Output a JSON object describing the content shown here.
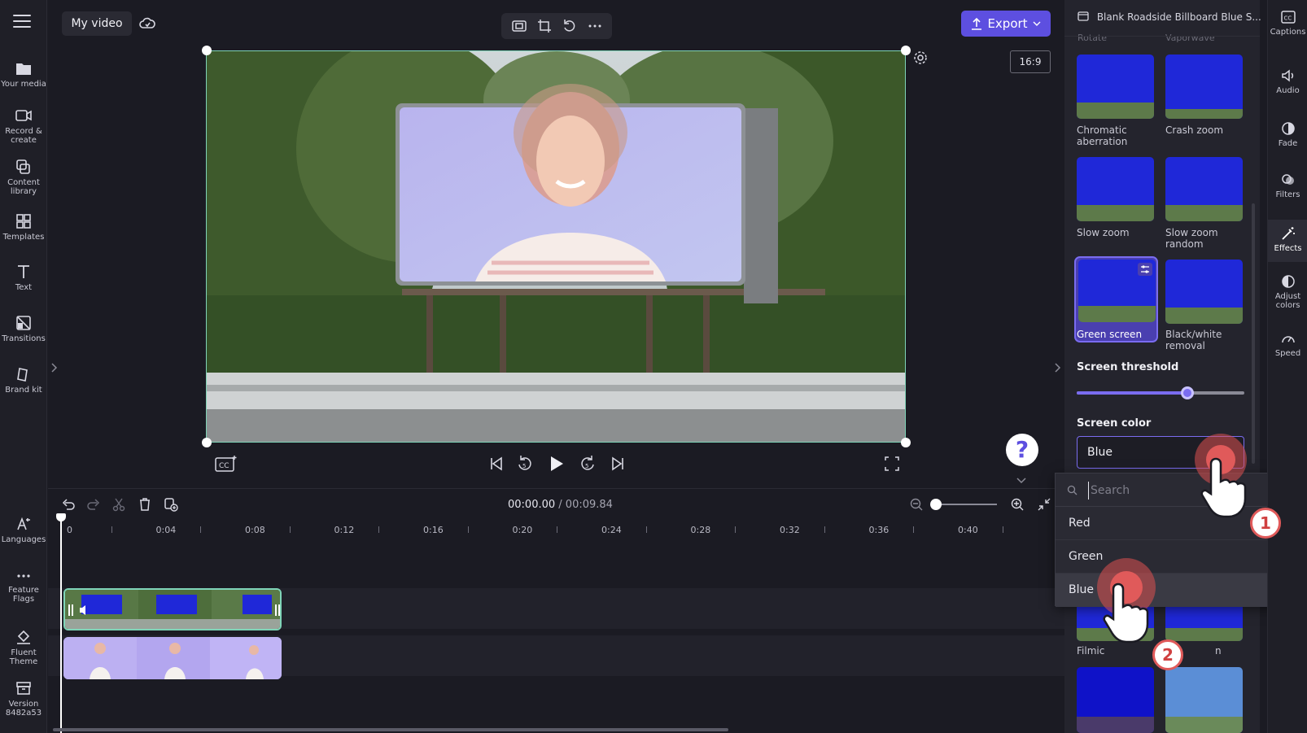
{
  "project": {
    "title": "My video"
  },
  "left_rail": {
    "items": [
      {
        "label": "Your media",
        "icon": "folder-icon"
      },
      {
        "label": "Record &\ncreate",
        "icon": "camera-icon"
      },
      {
        "label": "Content\nlibrary",
        "icon": "library-icon"
      },
      {
        "label": "Templates",
        "icon": "templates-icon"
      },
      {
        "label": "Text",
        "icon": "text-icon"
      },
      {
        "label": "Transitions",
        "icon": "transitions-icon"
      },
      {
        "label": "Brand kit",
        "icon": "brand-kit-icon"
      },
      {
        "label": "Languages",
        "icon": "languages-icon"
      },
      {
        "label": "Feature\nFlags",
        "icon": "more-icon"
      },
      {
        "label": "Fluent\nTheme",
        "icon": "paint-bucket-icon"
      },
      {
        "label": "Version\n8482a53",
        "icon": "archive-icon"
      }
    ]
  },
  "header": {
    "export_label": "Export",
    "aspect_ratio": "16:9"
  },
  "timeline": {
    "current_time": "00:00.00",
    "total_time": "/ 00:09.84",
    "ticks": [
      "0",
      "0:04",
      "0:08",
      "0:12",
      "0:16",
      "0:20",
      "0:24",
      "0:28",
      "0:32",
      "0:36",
      "0:40"
    ]
  },
  "help": {
    "label": "?"
  },
  "panel": {
    "asset_title": "Blank Roadside Billboard Blue S...",
    "cut_labels": [
      "Rotate",
      "Vaporwave"
    ],
    "effects": [
      {
        "label": "Chromatic\naberration"
      },
      {
        "label": "Crash zoom"
      },
      {
        "label": "Slow zoom"
      },
      {
        "label": "Slow zoom\nrandom"
      },
      {
        "label": "Green screen",
        "selected": true
      },
      {
        "label": "Black/white\nremoval"
      },
      {
        "label": "Filmic"
      },
      {
        "label": "n"
      }
    ],
    "threshold_title": "Screen threshold",
    "threshold_value": 0.66,
    "color_title": "Screen color",
    "color_value": "Blue"
  },
  "dropdown": {
    "search_placeholder": "Search",
    "options": [
      "Red",
      "Green",
      "Blue"
    ],
    "selected": "Blue"
  },
  "right_rail": {
    "items": [
      {
        "label": "Captions",
        "icon": "captions-icon"
      },
      {
        "label": "Audio",
        "icon": "speaker-icon"
      },
      {
        "label": "Fade",
        "icon": "fade-icon"
      },
      {
        "label": "Filters",
        "icon": "filters-icon"
      },
      {
        "label": "Effects",
        "icon": "magic-wand-icon",
        "active": true
      },
      {
        "label": "Adjust\ncolors",
        "icon": "adjust-colors-icon"
      },
      {
        "label": "Speed",
        "icon": "speedometer-icon"
      }
    ]
  },
  "annotations": {
    "step1": "1",
    "step2": "2"
  },
  "colors": {
    "accent": "#5d4fe0",
    "selection": "#7fd4b8",
    "cursor": "#e05a5a"
  }
}
